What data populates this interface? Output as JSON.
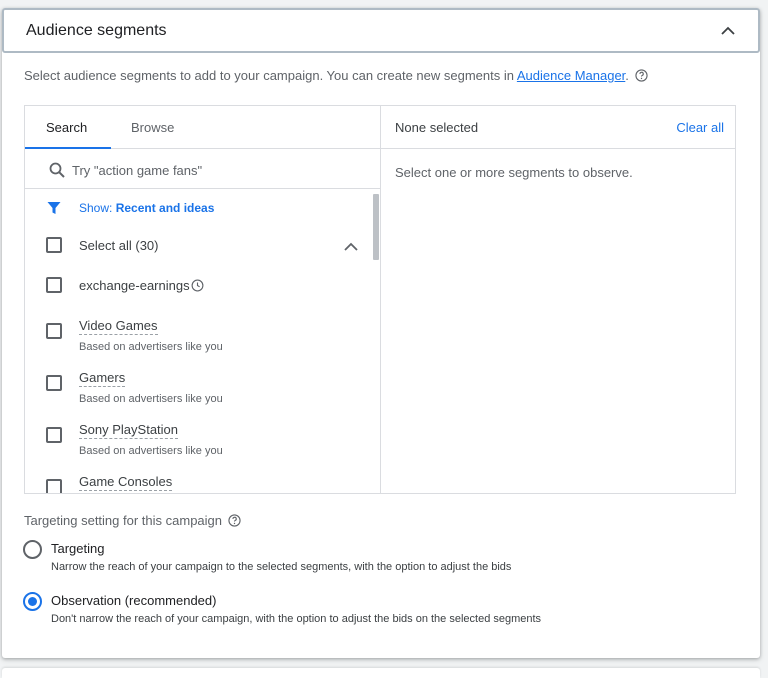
{
  "header": {
    "title": "Audience segments"
  },
  "intro": {
    "text": "Select audience segments to add to your campaign. You can create new segments in ",
    "link": "Audience Manager",
    "suffix": "."
  },
  "tabs": [
    {
      "label": "Search"
    },
    {
      "label": "Browse"
    }
  ],
  "search": {
    "placeholder": "Try \"action game fans\"",
    "value": ""
  },
  "filter": {
    "prefix": "Show: ",
    "value": "Recent and ideas"
  },
  "select_all": {
    "label": "Select all (30)"
  },
  "items": [
    {
      "label": "exchange-earnings",
      "sub": ""
    },
    {
      "label": "Video Games",
      "sub": "Based on advertisers like you"
    },
    {
      "label": "Gamers",
      "sub": "Based on advertisers like you"
    },
    {
      "label": "Sony PlayStation",
      "sub": "Based on advertisers like you"
    },
    {
      "label": "Game Consoles",
      "sub": ""
    }
  ],
  "selected": {
    "title": "None selected",
    "clear_label": "Clear all",
    "hint": "Select one or more segments to observe."
  },
  "targeting": {
    "title": "Targeting setting for this campaign",
    "options": [
      {
        "label": "Targeting",
        "desc": "Narrow the reach of your campaign to the selected segments, with the option to adjust the bids",
        "checked": false
      },
      {
        "label": "Observation (recommended)",
        "desc": "Don't narrow the reach of your campaign, with the option to adjust the bids on the selected segments",
        "checked": true
      }
    ]
  },
  "colors": {
    "accent": "#1a73e8",
    "border": "#dadce0",
    "text": "#3c4043",
    "muted": "#5f6368"
  },
  "icons": [
    "chevron-up-icon",
    "help-icon",
    "search-icon",
    "filter-icon",
    "clock-icon"
  ]
}
